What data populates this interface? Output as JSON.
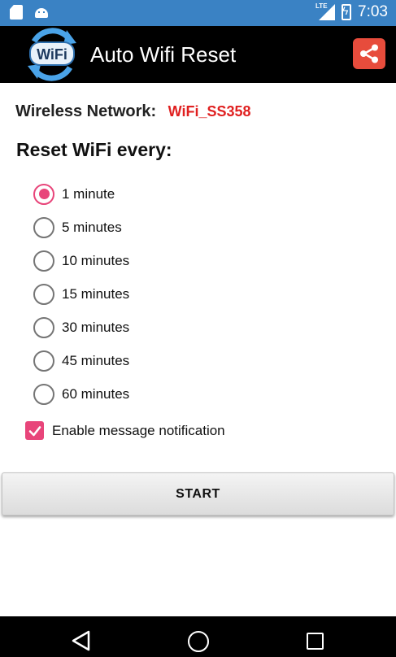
{
  "status_bar": {
    "time": "7:03",
    "network_type": "LTE",
    "icons": [
      "sd-card-icon",
      "android-icon",
      "signal-icon",
      "battery-charging-icon"
    ]
  },
  "app_bar": {
    "title": "Auto Wifi Reset",
    "logo_text": "WiFi",
    "share_icon": "share-icon"
  },
  "network": {
    "label": "Wireless Network:",
    "value": "WiFi_SS358"
  },
  "reset": {
    "heading": "Reset WiFi every:",
    "selected": "1 minute",
    "options": [
      "1 minute",
      "5 minutes",
      "10 minutes",
      "15 minutes",
      "30 minutes",
      "45 minutes",
      "60 minutes"
    ]
  },
  "notification": {
    "label": "Enable message notification",
    "checked": true
  },
  "start_button": {
    "label": "START"
  },
  "nav_bar": {
    "icons": [
      "back-icon",
      "home-icon",
      "recents-icon"
    ]
  },
  "colors": {
    "status_bar": "#3a82c4",
    "app_bar": "#000000",
    "accent": "#e8457a",
    "network_value": "#e02020",
    "share_button": "#e74c3c"
  }
}
